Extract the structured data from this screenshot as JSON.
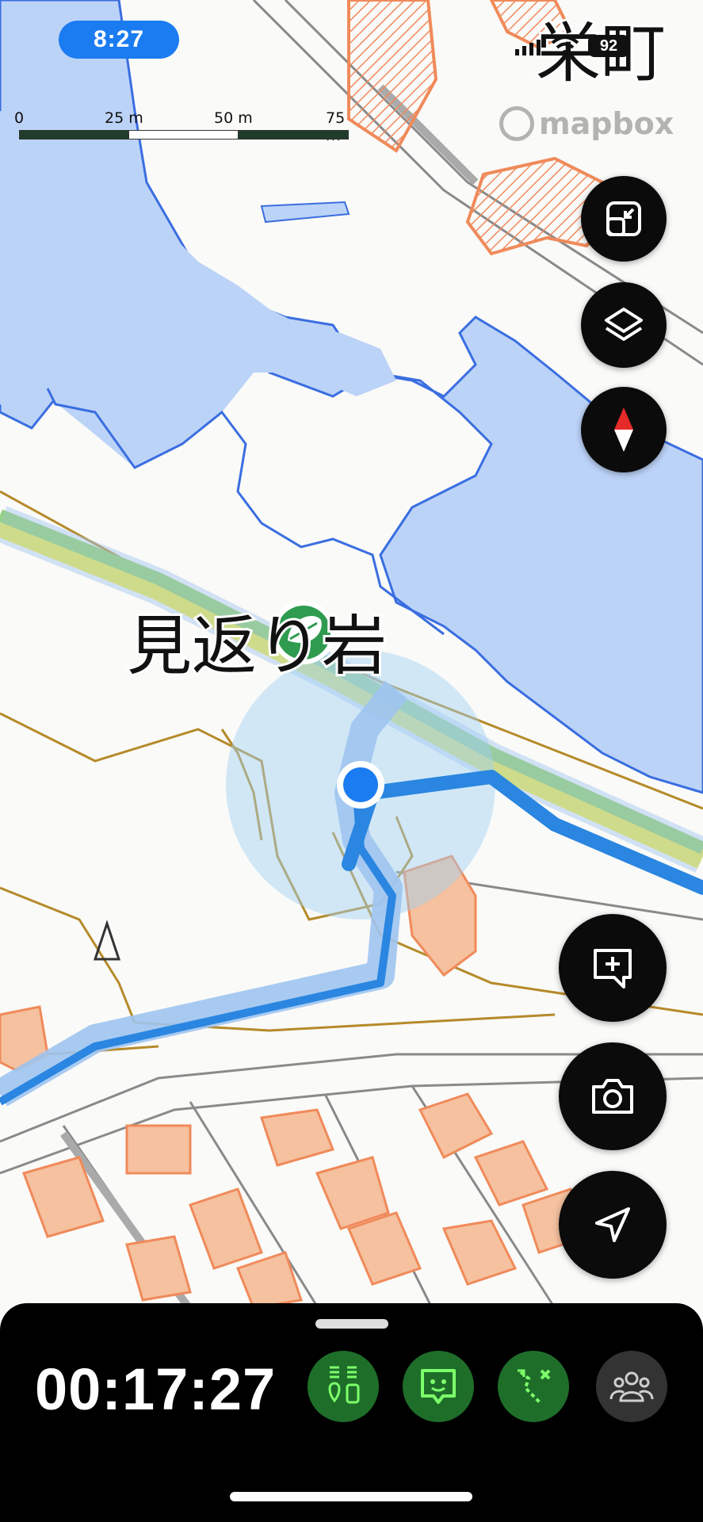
{
  "status_bar": {
    "time": "8:27",
    "battery": "92",
    "place_name": "栄町"
  },
  "scale_bar": {
    "ticks": [
      "0",
      "25 m",
      "50 m",
      "75 m"
    ]
  },
  "attribution": {
    "text": "mapbox"
  },
  "map": {
    "place_label": "見返り岩",
    "place_marker_icon": "leaf-icon",
    "location_marker_icon": "user-location-dot"
  },
  "map_controls": {
    "fit_icon": "collapse-icon",
    "layers_icon": "layers-icon",
    "compass_icon": "compass-icon",
    "add_note_icon": "add-note-icon",
    "camera_icon": "camera-icon",
    "locate_icon": "navigation-arrow-icon"
  },
  "bottom_bar": {
    "elapsed_time": "00:17:27",
    "actions": [
      {
        "icon": "people-pin-icon",
        "active": true
      },
      {
        "icon": "chat-face-icon",
        "active": true
      },
      {
        "icon": "route-icon",
        "active": true
      },
      {
        "icon": "group-icon",
        "active": false
      }
    ]
  },
  "colors": {
    "water": "#bcd3f8",
    "water_outline": "#3a6ee0",
    "building": "#f08a5a",
    "route": "#2a86e0",
    "trail_highlight": "#f4ee3a",
    "accent_green": "#1e6e2a",
    "bar_bg": "#000000",
    "time_pill": "#1a7cf0"
  }
}
